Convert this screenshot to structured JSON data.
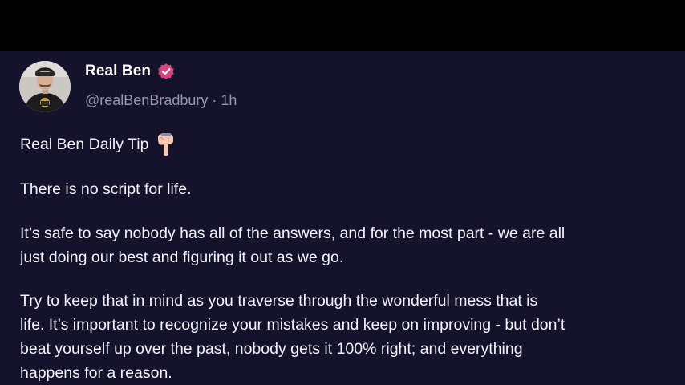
{
  "author": {
    "name": "Real Ben",
    "handle": "@realBenBradbury",
    "separator": "·",
    "time": "1h",
    "verified_color": "#d6457d"
  },
  "post": {
    "title": "Real Ben Daily Tip",
    "title_icon": "pointing-down-icon",
    "paragraph1": "There is no script for life.",
    "paragraph2_lines": [
      "It’s safe to say nobody has all of the answers, and for the most part - we are all",
      "just doing our best and figuring it out as we go."
    ],
    "paragraph3_lines": [
      "Try to keep that in mind as you traverse through the wonderful mess that is",
      "life. It’s important to recognize your mistakes and keep on improving - but don’t",
      "beat yourself up over the past, nobody gets it 100% right; and everything",
      "happens for a reason."
    ]
  },
  "colors": {
    "background": "#15122b",
    "text": "#f3f1fa",
    "muted": "#9a96ad"
  }
}
